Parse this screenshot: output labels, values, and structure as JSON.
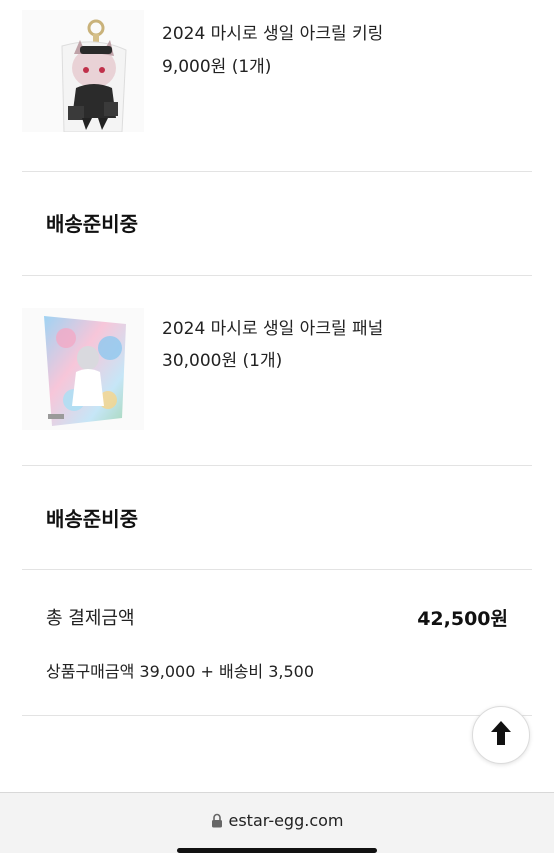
{
  "orders": [
    {
      "name": "2024 마시로 생일 아크릴 키링",
      "price": "9,000원 (1개)",
      "image_icon": "acrylic-keyring-image",
      "status": "배송준비중"
    },
    {
      "name": "2024 마시로 생일 아크릴 패널",
      "price": "30,000원 (1개)",
      "image_icon": "acrylic-panel-image",
      "status": "배송준비중"
    }
  ],
  "summary": {
    "total_label": "총 결제금액",
    "total_value": "42,500원",
    "breakdown": "상품구매금액 39,000 + 배송비 3,500"
  },
  "scroll_top_icon": "arrow-up-icon",
  "browser": {
    "url": "estar-egg.com",
    "lock_icon": "lock-icon"
  }
}
